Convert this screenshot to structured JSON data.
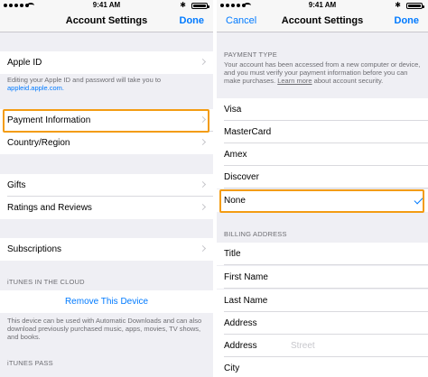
{
  "status": {
    "time": "9:41 AM",
    "bluetooth": "✱"
  },
  "left": {
    "nav_title": "Account Settings",
    "done": "Done",
    "apple_id": {
      "label": "Apple ID",
      "note": "Editing your Apple ID and password will take you to",
      "link": "appleid.apple.com."
    },
    "payment_information": "Payment Information",
    "country_region": "Country/Region",
    "gifts": "Gifts",
    "ratings_reviews": "Ratings and Reviews",
    "subscriptions": "Subscriptions",
    "cloud_header": "iTUNES IN THE CLOUD",
    "remove_device": "Remove This Device",
    "cloud_note": "This device can be used with Automatic Downloads and can also download previously purchased music, apps, movies, TV shows, and books.",
    "pass_header": "iTUNES PASS"
  },
  "right": {
    "cancel": "Cancel",
    "nav_title": "Account Settings",
    "done": "Done",
    "payment_type_header": "PAYMENT TYPE",
    "payment_note": "Your account has been accessed from a new computer or device, and you must verify your payment information before you can make purchases.",
    "learn_more": "Learn more",
    "payment_note_end": "about account security.",
    "payment_options": [
      "Visa",
      "MasterCard",
      "Amex",
      "Discover",
      "None"
    ],
    "selected": "None",
    "billing_header": "BILLING ADDRESS",
    "billing_fields": [
      {
        "label": "Title",
        "placeholder": ""
      },
      {
        "label": "First Name",
        "placeholder": ""
      },
      {
        "label": "Last Name",
        "placeholder": ""
      },
      {
        "label": "Address",
        "placeholder": ""
      },
      {
        "label": "Address",
        "placeholder": "Street"
      },
      {
        "label": "City",
        "placeholder": ""
      }
    ]
  },
  "colors": {
    "accent": "#007aff",
    "highlight": "#f39c12",
    "background": "#efeff4"
  }
}
